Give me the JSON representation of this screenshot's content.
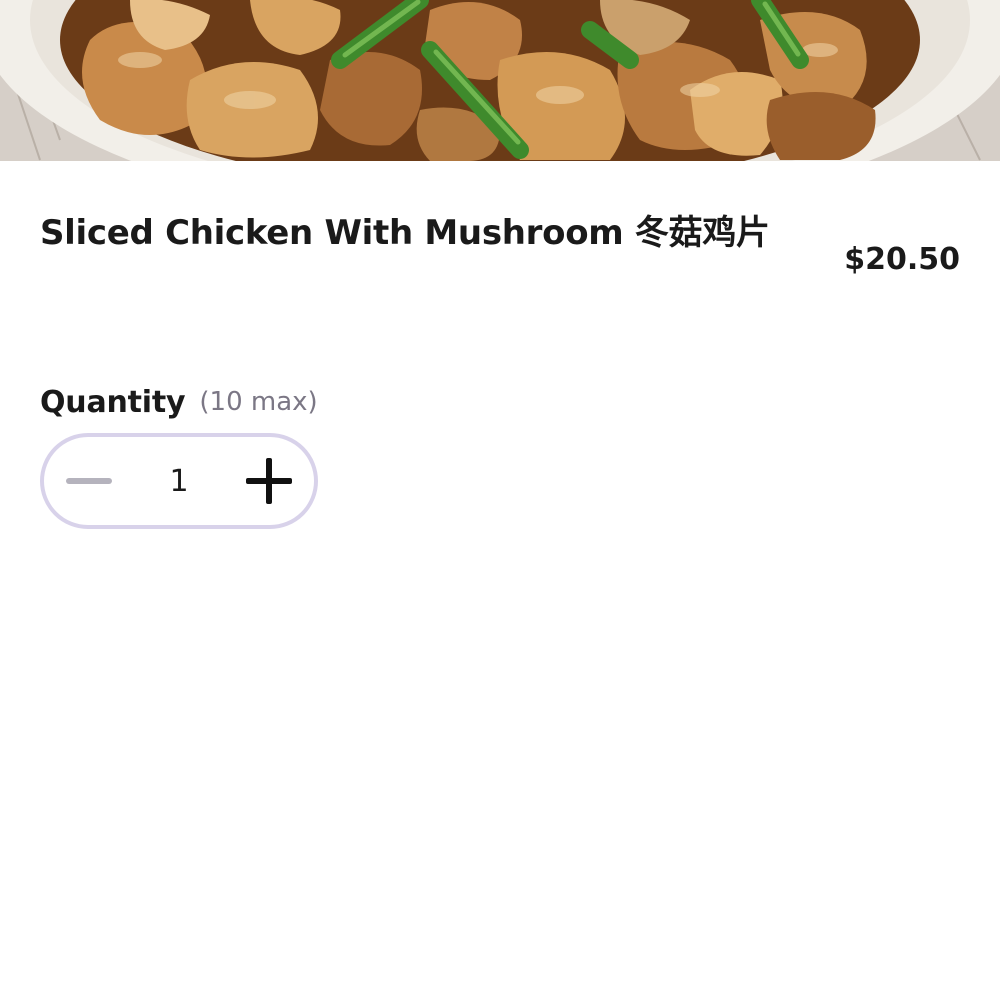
{
  "item": {
    "name": "Sliced Chicken With Mushroom 冬菇鸡片",
    "price": "$20.50"
  },
  "quantity": {
    "label": "Quantity",
    "max_text": "(10 max)",
    "value": "1"
  },
  "icons": {
    "decrement": "minus-icon",
    "increment": "plus-icon"
  },
  "colors": {
    "stepper_border": "#d8d2ea",
    "minus_disabled": "#b5b3bd",
    "text_primary": "#1a1a1a",
    "text_muted": "#7b7785"
  }
}
